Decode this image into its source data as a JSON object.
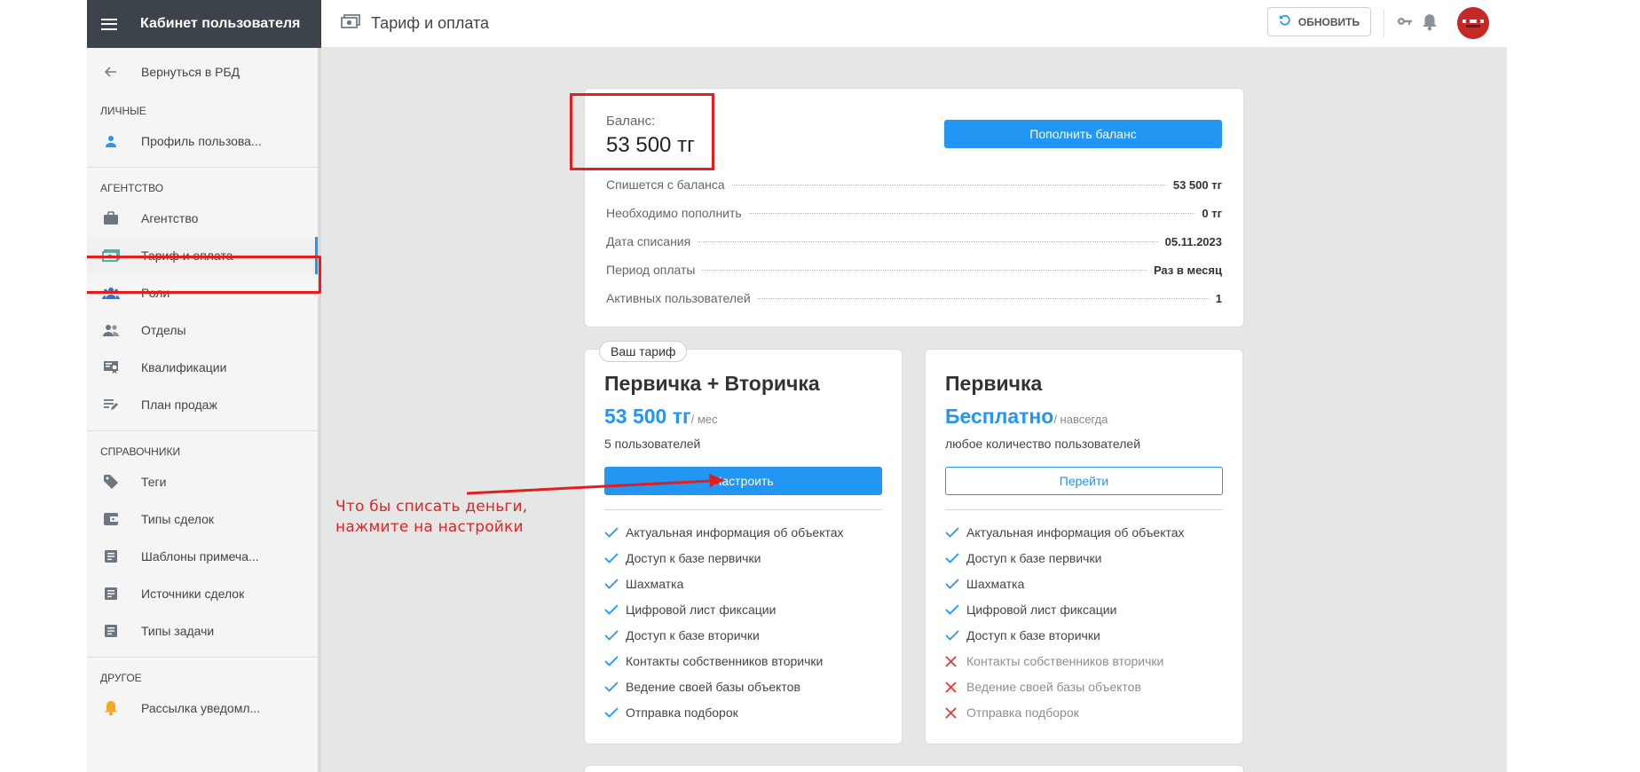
{
  "sidebar": {
    "title": "Кабинет пользователя",
    "back": "Вернуться в РБД",
    "sections": {
      "personal": "ЛИЧНЫЕ",
      "agency": "АГЕНТСТВО",
      "refs": "СПРАВОЧНИКИ",
      "other": "ДРУГОЕ"
    },
    "items": {
      "profile": "Профиль пользова...",
      "agency": "Агентство",
      "tariff": "Тариф и оплата",
      "roles": "Роли",
      "departments": "Отделы",
      "qualifications": "Квалификации",
      "sales_plan": "План продаж",
      "tags": "Теги",
      "deal_types": "Типы сделок",
      "note_templates": "Шаблоны примеча...",
      "deal_sources": "Источники сделок",
      "task_types": "Типы задачи",
      "notifications": "Рассылка уведомл..."
    }
  },
  "topbar": {
    "title": "Тариф и оплата",
    "refresh": "ОБНОВИТЬ"
  },
  "balance": {
    "label": "Баланс:",
    "value": "53 500 тг",
    "topup": "Пополнить баланс",
    "rows": [
      {
        "k": "Спишется с баланса",
        "v": "53 500 тг"
      },
      {
        "k": "Необходимо пополнить",
        "v": "0 тг"
      },
      {
        "k": "Дата списания",
        "v": "05.11.2023"
      },
      {
        "k": "Период оплаты",
        "v": "Раз в месяц"
      },
      {
        "k": "Активных пользователей",
        "v": "1"
      }
    ]
  },
  "tariffs": [
    {
      "badge": "Ваш тариф",
      "name": "Первичка + Вторичка",
      "price": "53 500 тг",
      "period": "/ мес",
      "users": "5 пользователей",
      "button": "Настроить",
      "features": [
        {
          "text": "Актуальная информация об объектах",
          "on": true
        },
        {
          "text": "Доступ к базе первички",
          "on": true
        },
        {
          "text": "Шахматка",
          "on": true
        },
        {
          "text": "Цифровой лист фиксации",
          "on": true
        },
        {
          "text": "Доступ к базе вторички",
          "on": true
        },
        {
          "text": "Контакты собственников вторички",
          "on": true
        },
        {
          "text": "Ведение своей базы объектов",
          "on": true
        },
        {
          "text": "Отправка подборок",
          "on": true
        }
      ]
    },
    {
      "name": "Первичка",
      "price": "Бесплатно",
      "period": "/ навсегда",
      "users": "любое количество пользователей",
      "button": "Перейти",
      "features": [
        {
          "text": "Актуальная информация об объектах",
          "on": true
        },
        {
          "text": "Доступ к базе первички",
          "on": true
        },
        {
          "text": "Шахматка",
          "on": true
        },
        {
          "text": "Цифровой лист фиксации",
          "on": true
        },
        {
          "text": "Доступ к базе вторички",
          "on": true
        },
        {
          "text": "Контакты собственников вторички",
          "on": false
        },
        {
          "text": "Ведение своей базы объектов",
          "on": false
        },
        {
          "text": "Отправка подборок",
          "on": false
        }
      ]
    }
  ],
  "annotation": {
    "line1": "Что бы списать деньги,",
    "line2": "нажмите на настройки"
  },
  "colors": {
    "accent": "#2196f3",
    "highlight": "#e21e1e",
    "sidebar_header": "#3d434a",
    "check": "#2196f3",
    "cross": "#e53935"
  }
}
